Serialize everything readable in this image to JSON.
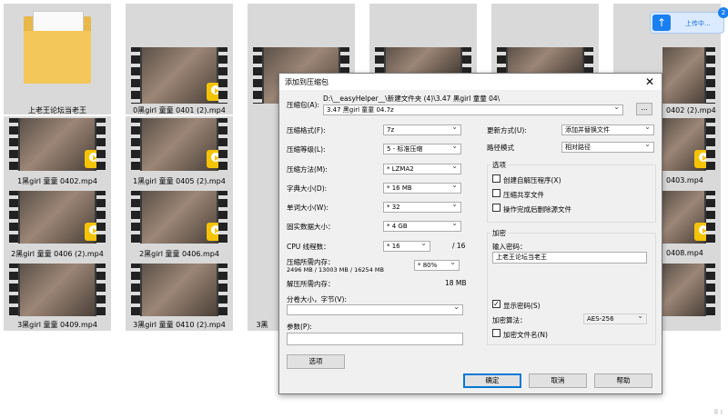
{
  "desktop": {
    "folder_label": "上老王论坛当老王",
    "videos": [
      "0黑girl 童童 0401 (2).mp4",
      "1黑girl 童童 0402.mp4",
      "1黑girl 童童 0405 (2).mp4",
      "2黑girl 童童 0406 (2).mp4",
      "2黑girl 童童 0406.mp4",
      "3黑girl 童童 0409.mp4",
      "3黑girl 童童 0410 (2).mp4",
      "3黑",
      "0402 (2).mp4",
      "0403.mp4",
      "0408.mp4"
    ],
    "play_badge": "Player"
  },
  "upload": {
    "label": "上传中...",
    "count": "2",
    "icon": "arrow-up-icon"
  },
  "corner_text": "⠿ ⁞",
  "dialog": {
    "title": "添加到压缩包",
    "archive_label": "压缩包(A):",
    "archive_path": "D:\\__easyHelper__\\新建文件夹 (4)\\3.47 黑girl 童童 04\\",
    "archive_name": "3.47 黑girl 童童 04.7z",
    "browse_label": "...",
    "format_label": "压缩格式(F):",
    "format_value": "7z",
    "level_label": "压缩等级(L):",
    "level_value": "5 - 标准压缩",
    "method_label": "压缩方法(M):",
    "method_value": "* LZMA2",
    "dict_label": "字典大小(D):",
    "dict_value": "* 16 MB",
    "word_label": "单词大小(W):",
    "word_value": "* 32",
    "solid_label": "固实数据大小：",
    "solid_value": "* 4 GB",
    "threads_label": "CPU 线程数：",
    "threads_value": "* 16",
    "threads_total": "/ 16",
    "mem_comp_label": "压缩所需内存：",
    "mem_comp_value": "2496 MB / 13003 MB / 16254 MB",
    "mem_pct": "* 80%",
    "mem_decomp_label": "解压所需内存：",
    "mem_decomp_value": "18 MB",
    "volume_label": "分卷大小，字节(V):",
    "volume_value": "",
    "params_label": "参数(P):",
    "params_value": "",
    "options_button": "选项",
    "update_label": "更新方式(U):",
    "update_value": "添加并替换文件",
    "path_label": "路径模式",
    "path_value": "相对路径",
    "options_group": "选项",
    "opt_sfx": "创建自解压程序(X)",
    "opt_shared": "压缩共享文件",
    "opt_delete": "操作完成后删除源文件",
    "encrypt_group": "加密",
    "password_label": "输入密码：",
    "password_value": "上老王论坛当老王",
    "show_password": "显示密码(S)",
    "enc_method_label": "加密算法：",
    "enc_method_value": "AES-256",
    "encrypt_names": "加密文件名(N)",
    "ok": "确定",
    "cancel": "取消",
    "help": "帮助"
  }
}
